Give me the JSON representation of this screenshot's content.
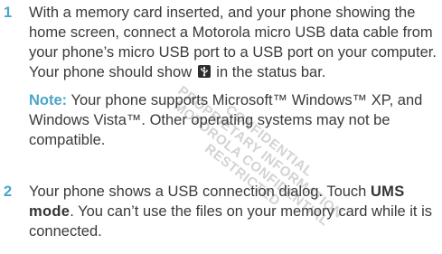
{
  "watermark": {
    "lines": [
      "CONFIDENTIAL",
      "PROPRIETARY INFORMATION",
      "MOTOROLA CONFIDENTIAL",
      "RESTRICTED"
    ]
  },
  "step1": {
    "number": "1",
    "text_before_icon": "With a memory card inserted, and your phone showing the home screen, connect a Motorola micro USB data cable from your phone’s micro USB port to a USB port on your computer. Your phone should show",
    "icon": "usb-icon",
    "text_after_icon": " in the status bar."
  },
  "note": {
    "label": "Note:",
    "text": " Your phone supports Microsoft™ Windows™ XP, and Windows Vista™. Other operating systems may not be compatible."
  },
  "step2": {
    "number": "2",
    "text_before": "Your phone shows a USB connection dialog. Touch ",
    "highlight": "UMS mode",
    "text_after": ". You can’t use the files on your memory card while it is connected."
  }
}
